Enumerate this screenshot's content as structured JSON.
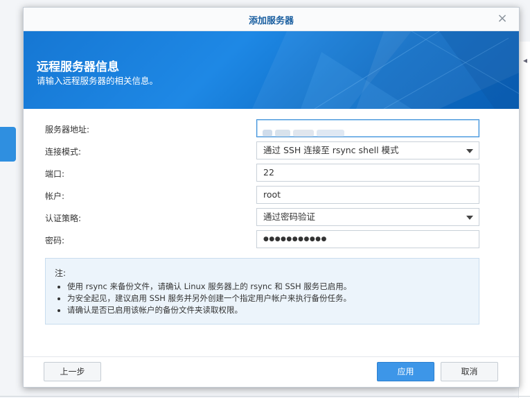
{
  "dialog": {
    "title": "添加服务器",
    "close_symbol": "×",
    "banner": {
      "title": "远程服务器信息",
      "subtitle": "请输入远程服务器的相关信息。"
    }
  },
  "form": {
    "server_address": {
      "label": "服务器地址:",
      "value": ""
    },
    "connection_mode": {
      "label": "连接模式:",
      "value": "通过 SSH 连接至 rsync shell 模式"
    },
    "port": {
      "label": "端口:",
      "value": "22"
    },
    "account": {
      "label": "帐户:",
      "value": "root"
    },
    "auth_policy": {
      "label": "认证策略:",
      "value": "通过密码验证"
    },
    "password": {
      "label": "密码:",
      "value": "●●●●●●●●●●●"
    }
  },
  "note": {
    "title": "注:",
    "items": [
      "使用 rsync 来备份文件，请确认 Linux 服务器上的 rsync 和 SSH 服务已启用。",
      "为安全起见，建议启用 SSH 服务并另外创建一个指定用户帐户来执行备份任务。",
      "请确认是否已启用该帐户的备份文件夹读取权限。"
    ]
  },
  "footer": {
    "back_label": "上一步",
    "apply_label": "应用",
    "cancel_label": "取消"
  },
  "colors": {
    "primary": "#3d96e8",
    "banner": "#1e88e5",
    "title": "#1a5fa0"
  }
}
